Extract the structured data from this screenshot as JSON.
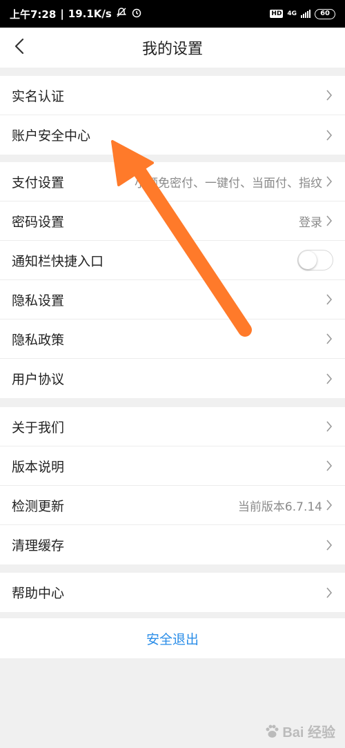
{
  "status_bar": {
    "time": "上午7:28",
    "speed": "19.1K/s",
    "hd": "HD",
    "network": "4G",
    "battery": "60"
  },
  "header": {
    "title": "我的设置"
  },
  "sections": [
    {
      "rows": [
        {
          "label": "实名认证",
          "value": ""
        },
        {
          "label": "账户安全中心",
          "value": ""
        }
      ]
    },
    {
      "rows": [
        {
          "label": "支付设置",
          "value": "小额免密付、一键付、当面付、指纹"
        },
        {
          "label": "密码设置",
          "value": "登录"
        },
        {
          "label": "通知栏快捷入口",
          "toggle": false
        },
        {
          "label": "隐私设置",
          "value": ""
        },
        {
          "label": "隐私政策",
          "value": ""
        },
        {
          "label": "用户协议",
          "value": ""
        }
      ]
    },
    {
      "rows": [
        {
          "label": "关于我们",
          "value": ""
        },
        {
          "label": "版本说明",
          "value": ""
        },
        {
          "label": "检测更新",
          "value": "当前版本6.7.14"
        },
        {
          "label": "清理缓存",
          "value": ""
        }
      ]
    },
    {
      "rows": [
        {
          "label": "帮助中心",
          "value": ""
        }
      ]
    }
  ],
  "logout_label": "安全退出",
  "watermark": "Bai 经验",
  "colors": {
    "accent_link": "#2a8de8",
    "annotation_arrow": "#ff7a2a",
    "background": "#f0f0f0"
  }
}
